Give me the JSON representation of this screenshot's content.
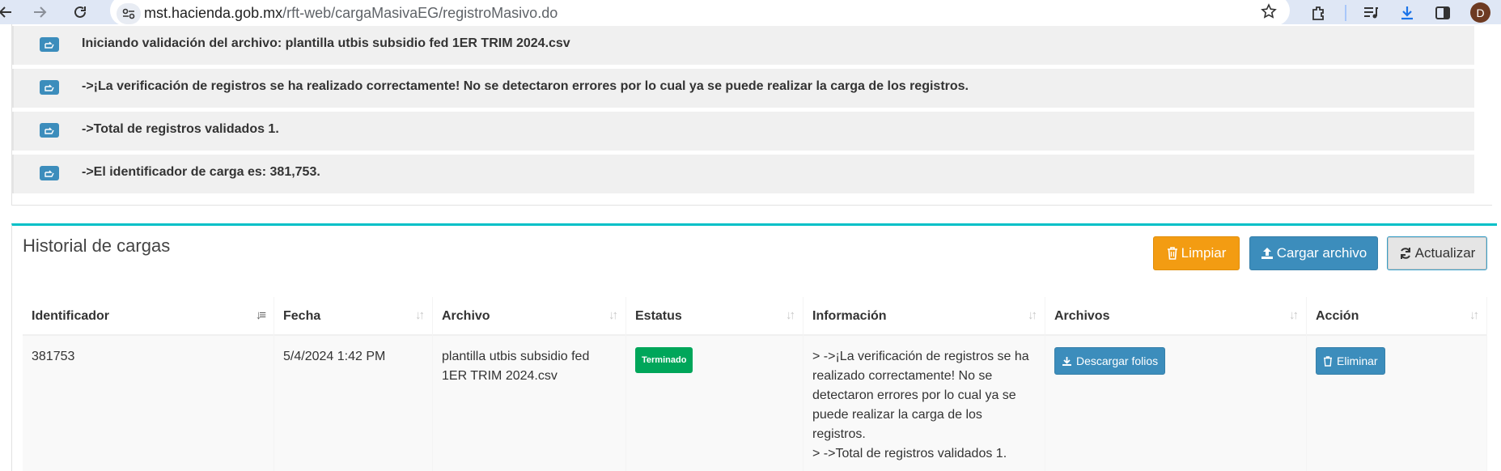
{
  "browser": {
    "url_domain": "mst.hacienda.gob.mx",
    "url_path": "/rft-web/cargaMasivaEG/registroMasivo.do",
    "avatar_letter": "D"
  },
  "log": {
    "items": [
      "Iniciando validación del archivo: plantilla utbis subsidio fed 1ER TRIM 2024.csv",
      "->¡La verificación de registros se ha realizado correctamente! No se detectaron errores por lo cual ya se puede realizar la carga de los registros.",
      "->Total de registros validados 1.",
      "->El identificador de carga es: 381,753."
    ]
  },
  "history": {
    "title": "Historial de cargas",
    "buttons": {
      "clear": "Limpiar",
      "upload": "Cargar archivo",
      "refresh": "Actualizar"
    },
    "columns": [
      "Identificador",
      "Fecha",
      "Archivo",
      "Estatus",
      "Información",
      "Archivos",
      "Acción"
    ],
    "rows": [
      {
        "id": "381753",
        "date": "5/4/2024 1:42 PM",
        "file": "plantilla utbis subsidio fed 1ER TRIM 2024.csv",
        "status": "Terminado",
        "info_1": "> ->¡La verificación de registros se ha realizado correctamente! No se detectaron errores por lo cual ya se puede realizar la carga de los registros.",
        "info_2": "> ->Total de registros validados 1.",
        "download": "Descargar folios",
        "delete": "Eliminar"
      }
    ]
  },
  "colors": {
    "primary": "#3c8dbc",
    "warning": "#f39c12",
    "success": "#00a65a",
    "box_accent": "#00c0c7"
  }
}
